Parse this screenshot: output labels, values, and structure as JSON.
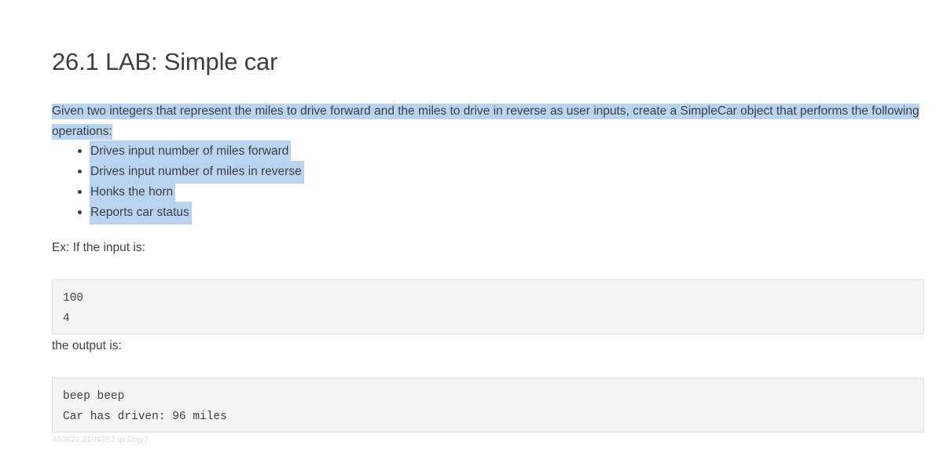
{
  "page": {
    "title": "26.1 LAB: Simple car",
    "footer_id": "460822.3109352.qx3zqy7",
    "highlight_color": "#b9d3f0",
    "text_color": "#3c4043",
    "code_bg": "#f5f5f5",
    "code_border": "#e3e3e3",
    "background": "#ffffff"
  },
  "intro": {
    "text": "Given two integers that represent the miles to drive forward and the miles to drive in reverse as user inputs, create a SimpleCar object that performs the following operations:"
  },
  "operations": [
    {
      "label": "Drives input number of miles forward"
    },
    {
      "label": "Drives input number of miles in reverse"
    },
    {
      "label": "Honks the horn"
    },
    {
      "label": "Reports car status"
    }
  ],
  "example": {
    "input_lead": "Ex: If the input is:",
    "input_code": "100\n4",
    "output_lead": "the output is:",
    "output_code": "beep beep\nCar has driven: 96 miles"
  }
}
